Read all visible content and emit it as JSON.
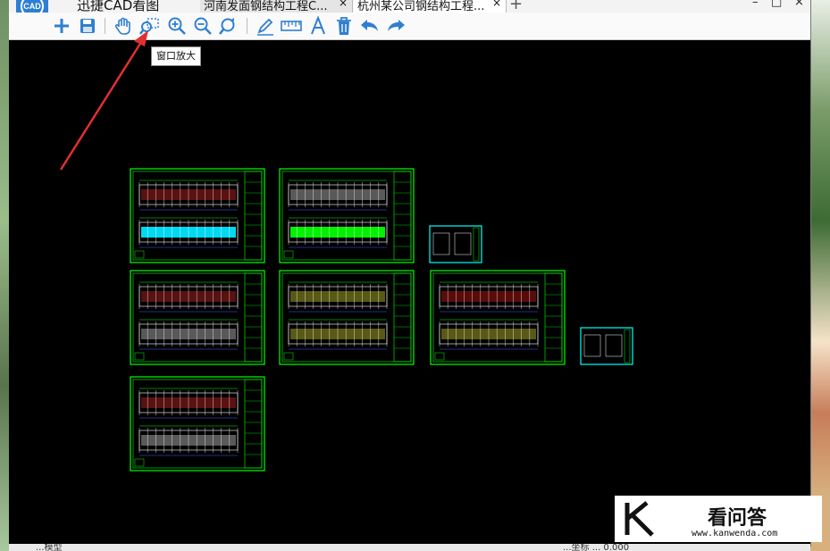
{
  "app": {
    "logo_text": "CAD",
    "title": "迅捷CAD看图"
  },
  "tabs": [
    {
      "label": "河南发面钢结构工程C...",
      "close": "×"
    },
    {
      "label": "杭州某公司钢结构工程...",
      "close": "×"
    }
  ],
  "tab_add": "+",
  "window_controls": {
    "minimize": "–",
    "maximize": "□",
    "close": "×"
  },
  "toolbar": {
    "buttons": [
      {
        "name": "new-icon",
        "color": "#2f7fd1"
      },
      {
        "name": "save-icon",
        "color": "#2f7fd1"
      },
      {
        "name": "pan-hand-icon",
        "color": "#2f7fd1"
      },
      {
        "name": "window-zoom-icon",
        "color": "#2f7fd1"
      },
      {
        "name": "zoom-in-icon",
        "color": "#2f7fd1"
      },
      {
        "name": "zoom-out-icon",
        "color": "#2f7fd1"
      },
      {
        "name": "zoom-extents-icon",
        "color": "#2f7fd1"
      },
      {
        "name": "pen-icon",
        "color": "#2f7fd1"
      },
      {
        "name": "measure-ruler-icon",
        "color": "#2f7fd1"
      },
      {
        "name": "text-icon",
        "color": "#2f7fd1"
      },
      {
        "name": "delete-icon",
        "color": "#2f7fd1"
      },
      {
        "name": "undo-icon",
        "color": "#2f7fd1"
      },
      {
        "name": "redo-icon",
        "color": "#2f7fd1"
      }
    ],
    "tooltip": "窗口放大"
  },
  "canvas": {
    "background": "#000000",
    "sheet_color": "#00ff00",
    "cyan": "#00ffff"
  },
  "statusbar": {
    "left": "...模型",
    "right": "...坐标 ... 0.000"
  },
  "watermark": {
    "brand": "看问答",
    "url": "www.kanwenda.com"
  },
  "colors": {
    "accent": "#2f7fd1",
    "arrow": "#e03030"
  }
}
